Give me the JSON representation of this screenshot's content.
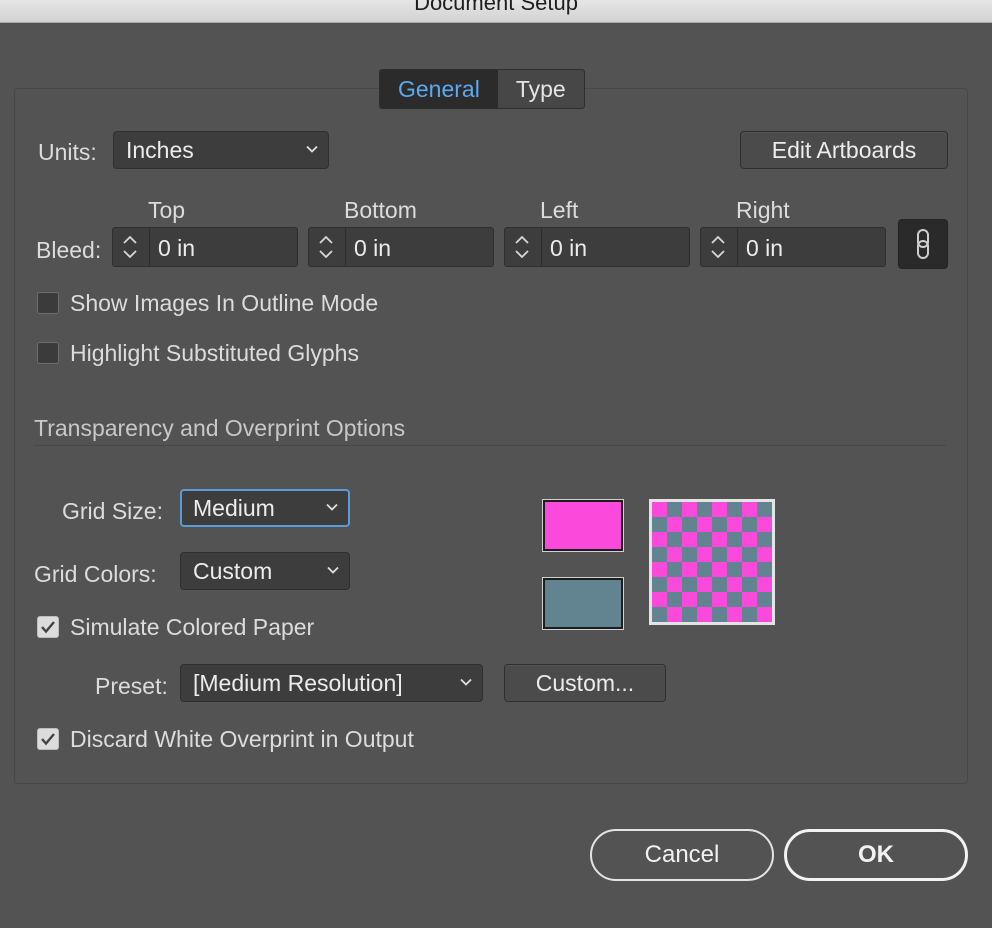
{
  "window": {
    "title": "Document Setup"
  },
  "tabs": [
    {
      "label": "General"
    },
    {
      "label": "Type"
    }
  ],
  "units": {
    "label": "Units:",
    "value": "Inches"
  },
  "edit_artboards": {
    "label": "Edit Artboards"
  },
  "bleed": {
    "label": "Bleed:",
    "fields": [
      {
        "header": "Top",
        "value": "0 in"
      },
      {
        "header": "Bottom",
        "value": "0 in"
      },
      {
        "header": "Left",
        "value": "0 in"
      },
      {
        "header": "Right",
        "value": "0 in"
      }
    ],
    "link_icon": "chain-link-icon"
  },
  "options": {
    "show_images_outline": {
      "label": "Show Images In Outline Mode",
      "checked": false
    },
    "highlight_glyphs": {
      "label": "Highlight Substituted Glyphs",
      "checked": false
    }
  },
  "transparency": {
    "section_title": "Transparency and Overprint Options",
    "grid_size": {
      "label": "Grid Size:",
      "value": "Medium"
    },
    "grid_colors": {
      "label": "Grid Colors:",
      "value": "Custom"
    },
    "simulate_paper": {
      "label": "Simulate Colored Paper",
      "checked": true
    },
    "preset": {
      "label": "Preset:",
      "value": "[Medium Resolution]"
    },
    "custom_button": {
      "label": "Custom..."
    },
    "discard_white": {
      "label": "Discard White Overprint in Output",
      "checked": true
    },
    "swatch_colors": {
      "color1": "#fb49db",
      "color2": "#628390"
    }
  },
  "footer": {
    "cancel_label": "Cancel",
    "ok_label": "OK"
  },
  "colors": {
    "accent": "#5ba9ee",
    "background": "#535353"
  }
}
